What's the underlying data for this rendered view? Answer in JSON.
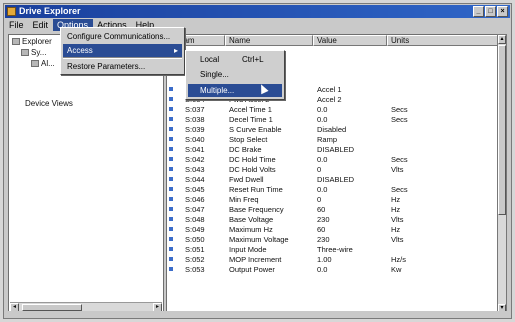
{
  "window": {
    "title": "Drive Explorer",
    "buttons": [
      "_",
      "□",
      "×"
    ]
  },
  "menubar": [
    "File",
    "Edit",
    "Options",
    "Actions",
    "Help"
  ],
  "menu_options": {
    "items": [
      {
        "label": "Configure Communications..."
      },
      {
        "label": "Access",
        "arrow": "▸"
      },
      {
        "label": "Restore Parameters..."
      }
    ]
  },
  "submenu_access": {
    "items": [
      {
        "label": "Local",
        "shortcut": "Ctrl+L"
      },
      {
        "label": "Single..."
      },
      {
        "label": "Multiple..."
      }
    ]
  },
  "tree": [
    {
      "label": "Explorer"
    },
    {
      "label": "Sy..."
    },
    {
      "label": "Al..."
    },
    {
      "label": "Device Views"
    }
  ],
  "list": {
    "headers": [
      "Param",
      "Name",
      "Value",
      "Units"
    ],
    "rows": [
      {
        "num": "S:033",
        "name": "Accel Time 1",
        "value": "Accel 1",
        "units": ""
      },
      {
        "num": "S:034",
        "name": "Fwd Accel 2",
        "value": "Accel 2",
        "units": ""
      },
      {
        "num": "S:037",
        "name": "Accel Time 1",
        "value": "0.0",
        "units": "Secs"
      },
      {
        "num": "S:038",
        "name": "Decel Time 1",
        "value": "0.0",
        "units": "Secs"
      },
      {
        "num": "S:039",
        "name": "S Curve Enable",
        "value": "Disabled",
        "units": ""
      },
      {
        "num": "S:040",
        "name": "Stop Select",
        "value": "Ramp",
        "units": ""
      },
      {
        "num": "S:041",
        "name": "DC Brake",
        "value": "DISABLED",
        "units": ""
      },
      {
        "num": "S:042",
        "name": "DC Hold Time",
        "value": "0.0",
        "units": "Secs"
      },
      {
        "num": "S:043",
        "name": "DC Hold Volts",
        "value": "0",
        "units": "Vlts"
      },
      {
        "num": "S:044",
        "name": "Fwd Dwell",
        "value": "DISABLED",
        "units": ""
      },
      {
        "num": "S:045",
        "name": "Reset Run Time",
        "value": "0.0",
        "units": "Secs"
      },
      {
        "num": "S:046",
        "name": "Min Freq",
        "value": "0",
        "units": "Hz"
      },
      {
        "num": "S:047",
        "name": "Base Frequency",
        "value": "60",
        "units": "Hz"
      },
      {
        "num": "S:048",
        "name": "Base Voltage",
        "value": "230",
        "units": "Vlts"
      },
      {
        "num": "S:049",
        "name": "Maximum Hz",
        "value": "60",
        "units": "Hz"
      },
      {
        "num": "S:050",
        "name": "Maximum Voltage",
        "value": "230",
        "units": "Vlts"
      },
      {
        "num": "S:051",
        "name": "Input Mode",
        "value": "Three-wire",
        "units": ""
      },
      {
        "num": "S:052",
        "name": "MOP Increment",
        "value": "1.00",
        "units": "Hz/s"
      },
      {
        "num": "S:053",
        "name": "Output Power",
        "value": "0.0",
        "units": "Kw"
      }
    ]
  },
  "colors": {
    "titlebar": "#1a3f9c",
    "highlight": "#2a4c94",
    "chrome": "#c9c9c9"
  }
}
